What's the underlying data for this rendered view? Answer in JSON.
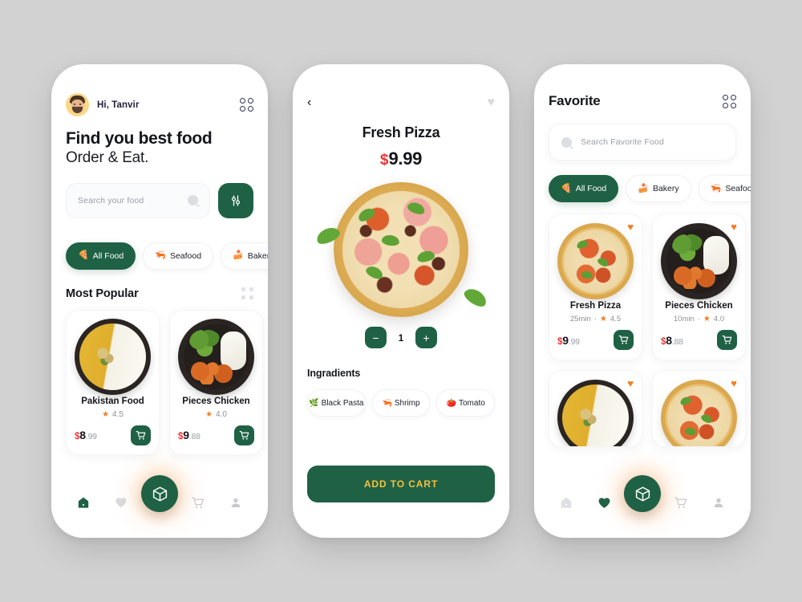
{
  "theme": {
    "background": "#d2d2d3",
    "brand_green": "#1f6145",
    "accent_orange": "#f57c1f",
    "price_red": "#ef3535",
    "cta_text_gold": "#f5c13c",
    "card_white": "#ffffff"
  },
  "home": {
    "greeting": "Hi, Tanvir",
    "headline_line1": "Find you best food",
    "headline_line2": "Order & Eat.",
    "search": {
      "placeholder": "Search your food",
      "icon": "search-icon"
    },
    "filter_icon": "sliders-icon",
    "menu_icon": "grid-menu-icon",
    "categories": [
      {
        "label": "All Food",
        "emoji": "🍕",
        "active": true
      },
      {
        "label": "Seafood",
        "emoji": "🦐",
        "active": false
      },
      {
        "label": "Bakery",
        "emoji": "🍰",
        "active": false
      }
    ],
    "section_title": "Most Popular",
    "section_more_icon": "grid-dots-icon",
    "popular": [
      {
        "name": "Pakistan Food",
        "rating": "4.5",
        "currency": "$",
        "price_int": "8",
        "price_dec": ".99",
        "image": "curry-rice-bowl"
      },
      {
        "name": "Pieces Chicken",
        "rating": "4.0",
        "currency": "$",
        "price_int": "9",
        "price_dec": ".88",
        "image": "broccoli-chicken-bowl"
      }
    ],
    "nav": [
      {
        "icon": "home-icon",
        "active": true
      },
      {
        "icon": "heart-icon",
        "active": false
      },
      {
        "icon": "cube-icon",
        "fab": true
      },
      {
        "icon": "cart-icon",
        "active": false
      },
      {
        "icon": "profile-icon",
        "active": false
      }
    ]
  },
  "detail": {
    "back_icon": "back-chevron-icon",
    "favorite_icon": "heart-icon",
    "name": "Fresh Pizza",
    "currency": "$",
    "price": "9.99",
    "hero_image": "fresh-pizza",
    "quantity": "1",
    "minus_label": "−",
    "plus_label": "+",
    "ingredients_title": "Ingradients",
    "ingredients": [
      {
        "label": "Black Pasta",
        "emoji": "🌿"
      },
      {
        "label": "Shrimp",
        "emoji": "🦐"
      },
      {
        "label": "Tomato",
        "emoji": "🍅"
      }
    ],
    "cta_label": "ADD TO CART"
  },
  "favorite": {
    "title": "Favorite",
    "menu_icon": "grid-menu-icon",
    "search": {
      "placeholder": "Search Favorite Food",
      "icon": "search-icon"
    },
    "categories": [
      {
        "label": "All Food",
        "emoji": "🍕",
        "active": true
      },
      {
        "label": "Bakery",
        "emoji": "🍰",
        "active": false
      },
      {
        "label": "Seafood",
        "emoji": "🦐",
        "active": false
      }
    ],
    "items": [
      {
        "name": "Fresh Pizza",
        "time": "25min",
        "sep": "·",
        "rating": "4.5",
        "currency": "$",
        "price_int": "9",
        "price_dec": ".99",
        "image": "pizza",
        "favorited": true
      },
      {
        "name": "Pieces Chicken",
        "time": "10min",
        "sep": "·",
        "rating": "4.0",
        "currency": "$",
        "price_int": "8",
        "price_dec": ".88",
        "image": "broccoli-chicken-bowl",
        "favorited": true
      }
    ],
    "items_row2": [
      {
        "image": "curry-rice-bowl",
        "favorited": true
      },
      {
        "image": "fresh-pizza",
        "favorited": true
      }
    ],
    "nav": [
      {
        "icon": "home-icon",
        "active": false
      },
      {
        "icon": "heart-icon",
        "active": true
      },
      {
        "icon": "cube-icon",
        "fab": true
      },
      {
        "icon": "cart-icon",
        "active": false
      },
      {
        "icon": "profile-icon",
        "active": false
      }
    ]
  }
}
